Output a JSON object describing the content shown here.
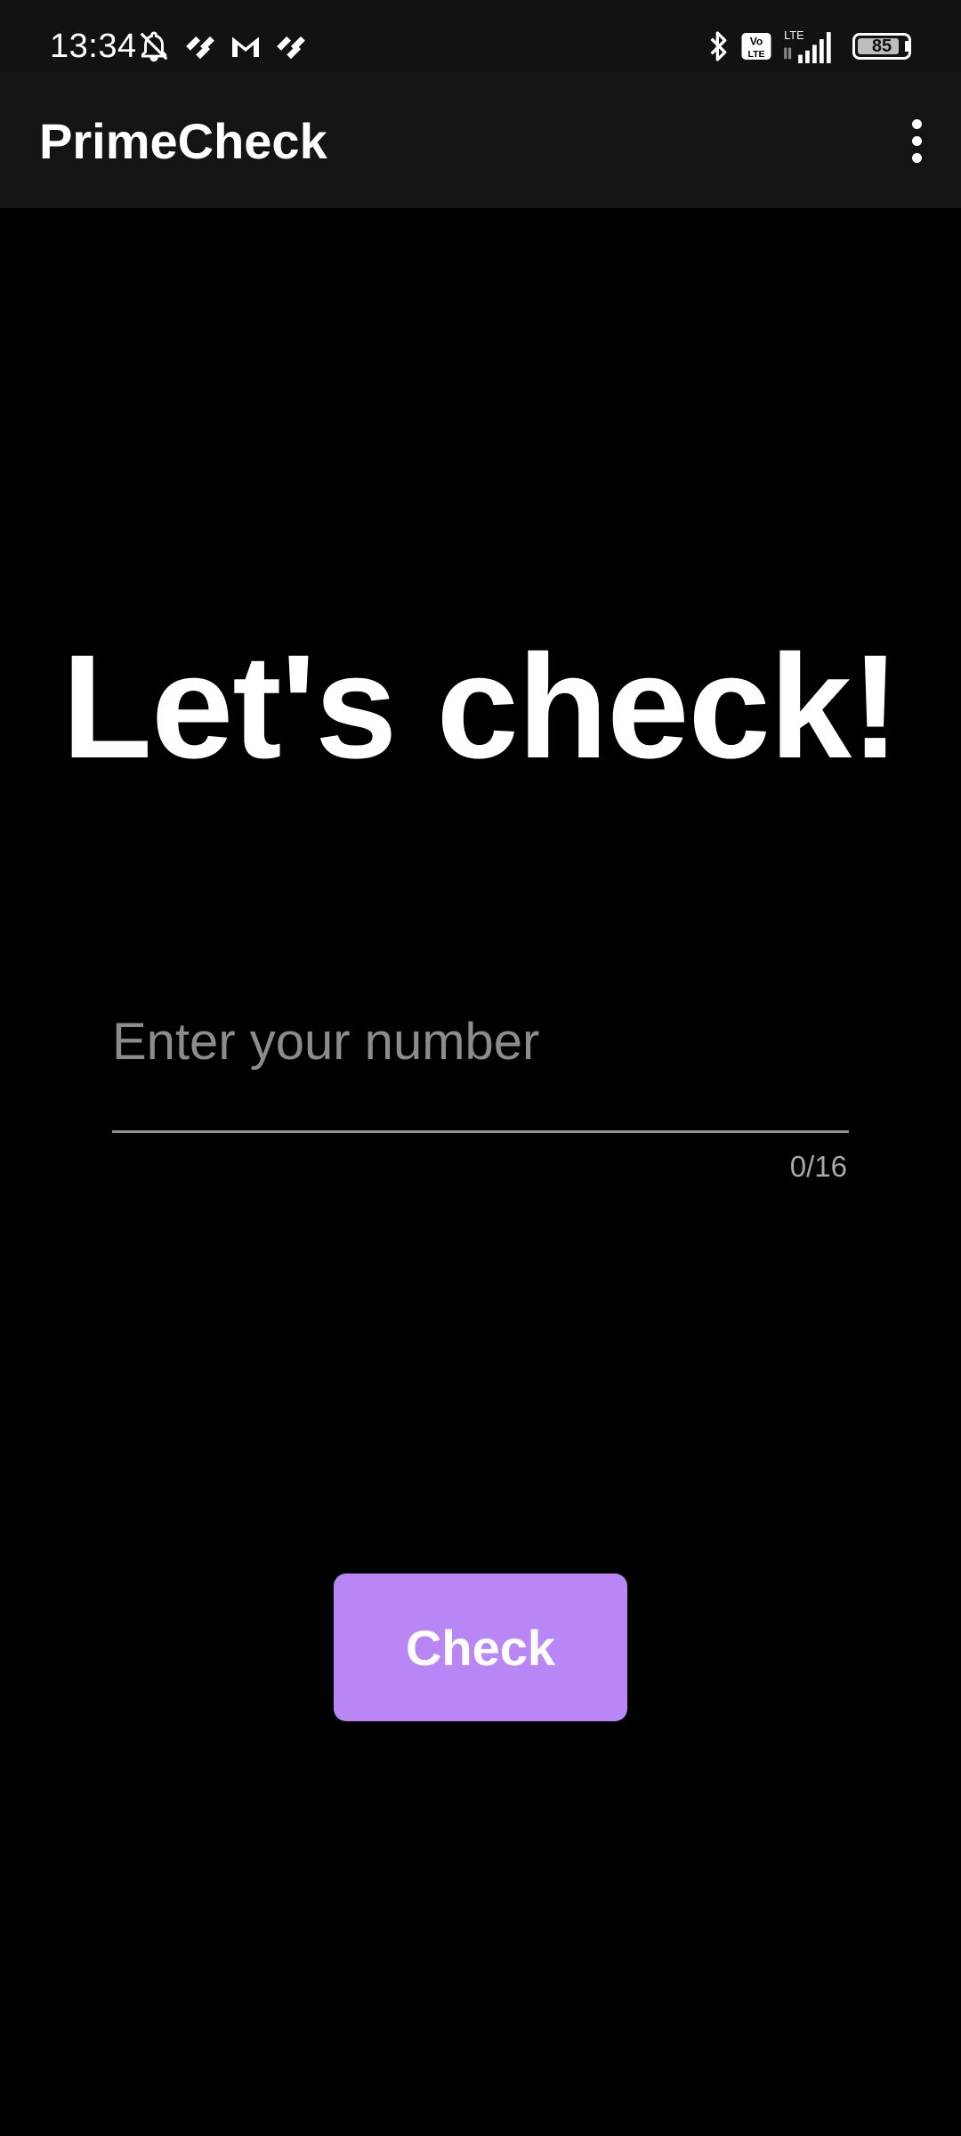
{
  "status_bar": {
    "time": "13:34",
    "battery_level": "85",
    "network": "LTE",
    "icons": [
      "bell-off-icon",
      "app-notification-icon",
      "gmail-icon",
      "app-notification-icon",
      "bluetooth-icon",
      "volte-icon",
      "signal-icon",
      "battery-icon"
    ]
  },
  "app_bar": {
    "title": "PrimeCheck",
    "menu_icon": "more-vert-icon"
  },
  "main": {
    "headline": "Let's check!",
    "input": {
      "value": "",
      "placeholder": "Enter your number"
    },
    "counter": "0/16",
    "check_button_label": "Check"
  },
  "colors": {
    "background": "#000000",
    "app_bar": "#141414",
    "accent": "#b987f5",
    "placeholder": "#8c8c8c"
  }
}
